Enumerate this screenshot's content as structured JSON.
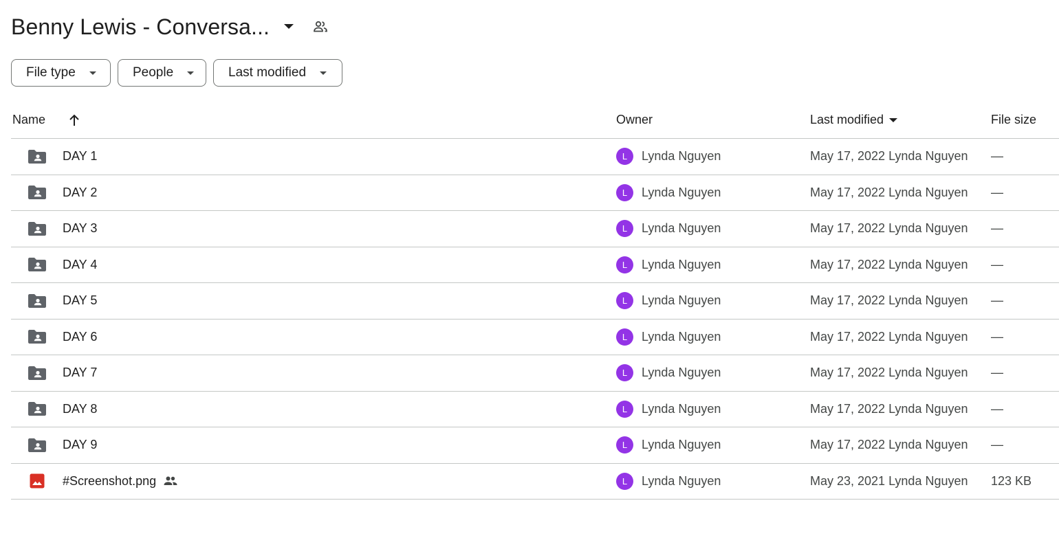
{
  "header": {
    "title": "Benny Lewis - Conversa..."
  },
  "filters": {
    "file_type": "File type",
    "people": "People",
    "last_modified": "Last modified"
  },
  "columns": {
    "name": "Name",
    "owner": "Owner",
    "last_modified": "Last modified",
    "file_size": "File size"
  },
  "rows": [
    {
      "name": "DAY 1",
      "type": "shared-folder-icon",
      "owner_initial": "L",
      "owner": "Lynda Nguyen",
      "modified": "May 17, 2022 Lynda Nguyen",
      "size": "—"
    },
    {
      "name": "DAY 2",
      "type": "shared-folder-icon",
      "owner_initial": "L",
      "owner": "Lynda Nguyen",
      "modified": "May 17, 2022 Lynda Nguyen",
      "size": "—"
    },
    {
      "name": "DAY 3",
      "type": "shared-folder-icon",
      "owner_initial": "L",
      "owner": "Lynda Nguyen",
      "modified": "May 17, 2022 Lynda Nguyen",
      "size": "—"
    },
    {
      "name": "DAY 4",
      "type": "shared-folder-icon",
      "owner_initial": "L",
      "owner": "Lynda Nguyen",
      "modified": "May 17, 2022 Lynda Nguyen",
      "size": "—"
    },
    {
      "name": "DAY 5",
      "type": "shared-folder-icon",
      "owner_initial": "L",
      "owner": "Lynda Nguyen",
      "modified": "May 17, 2022 Lynda Nguyen",
      "size": "—"
    },
    {
      "name": "DAY 6",
      "type": "shared-folder-icon",
      "owner_initial": "L",
      "owner": "Lynda Nguyen",
      "modified": "May 17, 2022 Lynda Nguyen",
      "size": "—"
    },
    {
      "name": "DAY 7",
      "type": "shared-folder-icon",
      "owner_initial": "L",
      "owner": "Lynda Nguyen",
      "modified": "May 17, 2022 Lynda Nguyen",
      "size": "—"
    },
    {
      "name": "DAY 8",
      "type": "shared-folder-icon",
      "owner_initial": "L",
      "owner": "Lynda Nguyen",
      "modified": "May 17, 2022 Lynda Nguyen",
      "size": "—"
    },
    {
      "name": "DAY 9",
      "type": "shared-folder-icon",
      "owner_initial": "L",
      "owner": "Lynda Nguyen",
      "modified": "May 17, 2022 Lynda Nguyen",
      "size": "—"
    },
    {
      "name": "#Screenshot.png",
      "type": "image-file-icon",
      "owner_initial": "L",
      "owner": "Lynda Nguyen",
      "modified": "May 23, 2021 Lynda Nguyen",
      "size": "123 KB"
    }
  ],
  "colors": {
    "avatar": "#9334e6",
    "folder_icon": "#5f6368",
    "image_icon": "#d93025",
    "divider": "#c4c7c5"
  }
}
